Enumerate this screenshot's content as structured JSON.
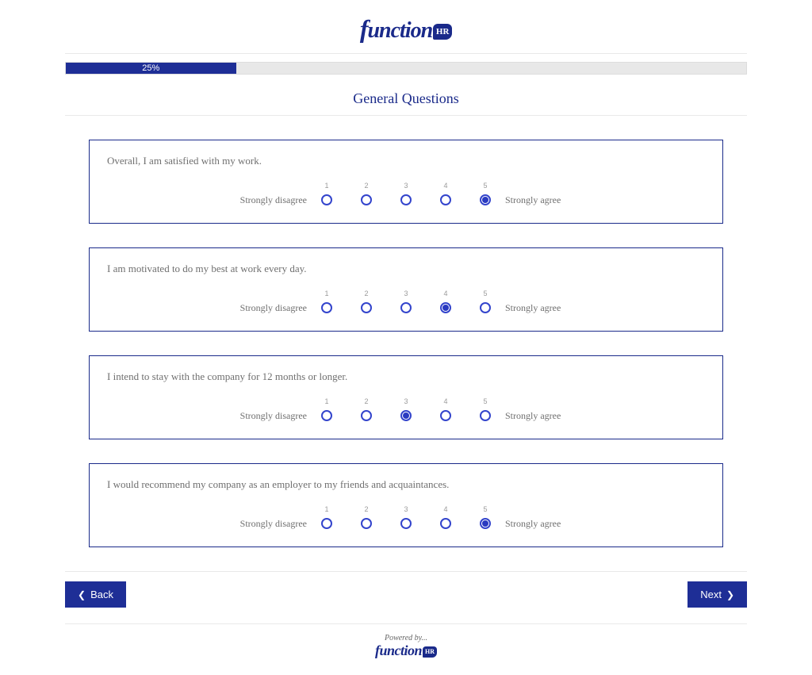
{
  "brand": {
    "prefix": "f",
    "rest": "unction",
    "badge": "HR"
  },
  "progress": {
    "percent": 25,
    "label": "25%"
  },
  "section_title": "General Questions",
  "scale": {
    "left_label": "Strongly disagree",
    "right_label": "Strongly agree",
    "options": [
      "1",
      "2",
      "3",
      "4",
      "5"
    ]
  },
  "questions": [
    {
      "text": "Overall, I am satisfied with my work.",
      "selected": 5
    },
    {
      "text": "I am motivated to do my best at work every day.",
      "selected": 4
    },
    {
      "text": "I intend to stay with the company for 12 months or longer.",
      "selected": 3
    },
    {
      "text": "I would recommend my company as an employer to my friends and acquaintances.",
      "selected": 5
    }
  ],
  "nav": {
    "back": "Back",
    "next": "Next"
  },
  "footer": {
    "powered": "Powered by..."
  }
}
